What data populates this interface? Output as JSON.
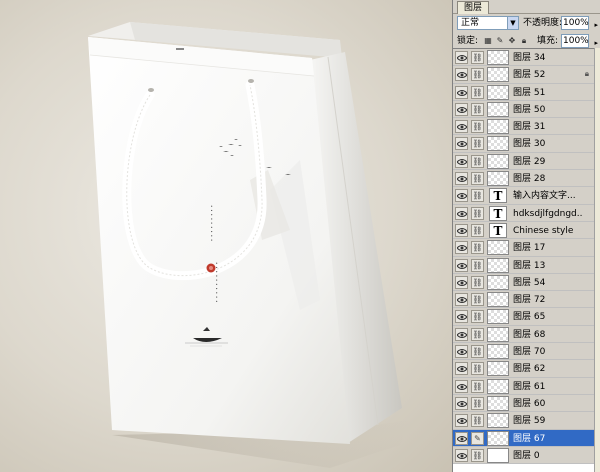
{
  "panel": {
    "tab": "图层",
    "blend_mode": "正常",
    "opacity_label": "不透明度:",
    "opacity_value": "100%",
    "lock_label": "锁定:",
    "fill_label": "填充:",
    "fill_value": "100%"
  },
  "layers": [
    {
      "name": "图层 34",
      "type": "pixel"
    },
    {
      "name": "图层 52",
      "type": "pixel",
      "locked": true
    },
    {
      "name": "图层 51",
      "type": "pixel"
    },
    {
      "name": "图层 50",
      "type": "pixel"
    },
    {
      "name": "图层 31",
      "type": "pixel"
    },
    {
      "name": "图层 30",
      "type": "pixel"
    },
    {
      "name": "图层 29",
      "type": "pixel"
    },
    {
      "name": "图层 28",
      "type": "pixel"
    },
    {
      "name": "输入内容文字...",
      "type": "text"
    },
    {
      "name": "hdksdjlfgdngd...",
      "type": "text"
    },
    {
      "name": "Chinese style",
      "type": "text"
    },
    {
      "name": "图层 17",
      "type": "pixel"
    },
    {
      "name": "图层 13",
      "type": "pixel"
    },
    {
      "name": "图层 54",
      "type": "pixel"
    },
    {
      "name": "图层 72",
      "type": "pixel"
    },
    {
      "name": "图层 65",
      "type": "pixel"
    },
    {
      "name": "图层 68",
      "type": "pixel"
    },
    {
      "name": "图层 70",
      "type": "pixel"
    },
    {
      "name": "图层 62",
      "type": "pixel"
    },
    {
      "name": "图层 61",
      "type": "pixel"
    },
    {
      "name": "图层 60",
      "type": "pixel"
    },
    {
      "name": "图层 59",
      "type": "pixel"
    },
    {
      "name": "图层 67",
      "type": "pixel",
      "selected": true
    },
    {
      "name": "图层 0",
      "type": "white"
    }
  ],
  "icons": {
    "eye": "eye-icon",
    "link": "link-icon",
    "text_layer": "text-layer-icon",
    "lock": "lock-icon"
  },
  "colors": {
    "selection": "#316ac5",
    "panel_bg": "#d4d0c8"
  }
}
